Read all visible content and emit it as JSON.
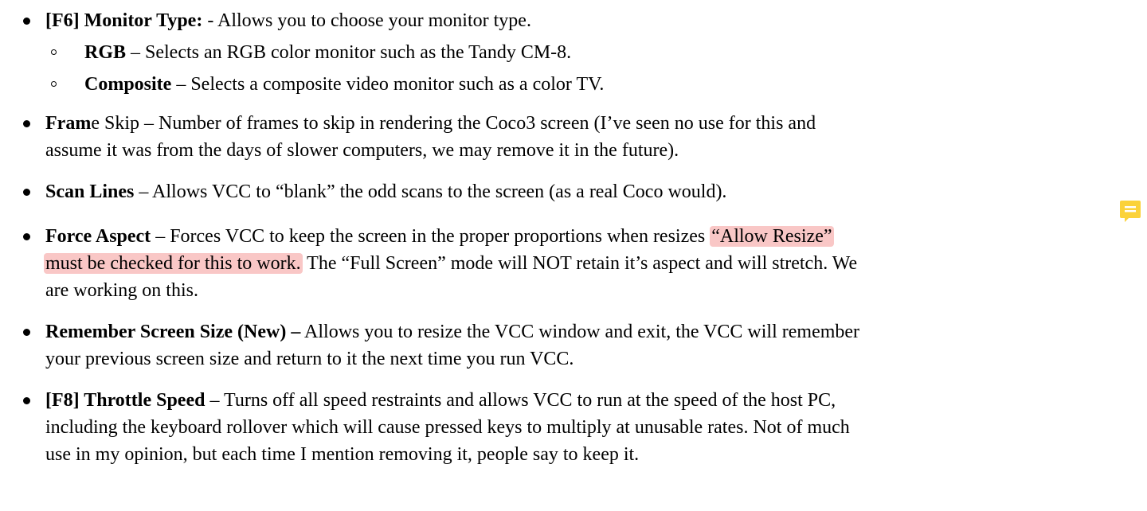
{
  "items": [
    {
      "lines": [
        {
          "bold": "[F6] Monitor Type:",
          "text": " - Allows you to choose your monitor type."
        }
      ],
      "subitems": [
        {
          "bold": "RGB",
          "text": " – Selects an RGB color monitor such as the Tandy CM-8."
        },
        {
          "bold": "Composite",
          "text": " – Selects a composite video monitor such as a color TV."
        }
      ]
    },
    {
      "lines": [
        {
          "bold": "Fram",
          "text": "e Skip – Number of frames to skip in rendering the Coco3 screen (I’ve seen no use for this and"
        },
        {
          "text": "assume it was from the days of slower computers, we may remove it in the future)."
        }
      ]
    },
    {
      "lines": [
        {
          "bold": "Scan Lines",
          "text": " – Allows VCC to “blank” the odd scans to the screen (as a real Coco would)."
        }
      ]
    },
    {
      "lines": [
        {
          "bold": "Force Aspect",
          "text": " – Forces VCC to keep the screen in the proper proportions when resizes ",
          "highlight": "“Allow Resize”"
        },
        {
          "highlight": "must be checked for this to work.",
          "text": " The “Full Screen” mode will NOT retain it’s aspect and will stretch. We"
        },
        {
          "text": "are working on this."
        }
      ]
    },
    {
      "lines": [
        {
          "bold": "Remember Screen Size (New) –",
          "text": " Allows you to resize the VCC window and exit, the VCC will remember"
        },
        {
          "text": "your previous screen size and return to it the next time you run VCC."
        }
      ]
    },
    {
      "lines": [
        {
          "bold": "[F8] Throttle Speed",
          "text": " – Turns off all speed restraints and allows VCC to run at the speed of the host PC,"
        },
        {
          "text": "including the keyboard rollover which will cause pressed keys to multiply at unusable rates. Not of much"
        },
        {
          "text": "use in my opinion, but each time I mention removing it, people say to keep it."
        }
      ]
    }
  ],
  "comment_icon": {
    "name": "comment-icon",
    "color": "#fbd23a"
  }
}
